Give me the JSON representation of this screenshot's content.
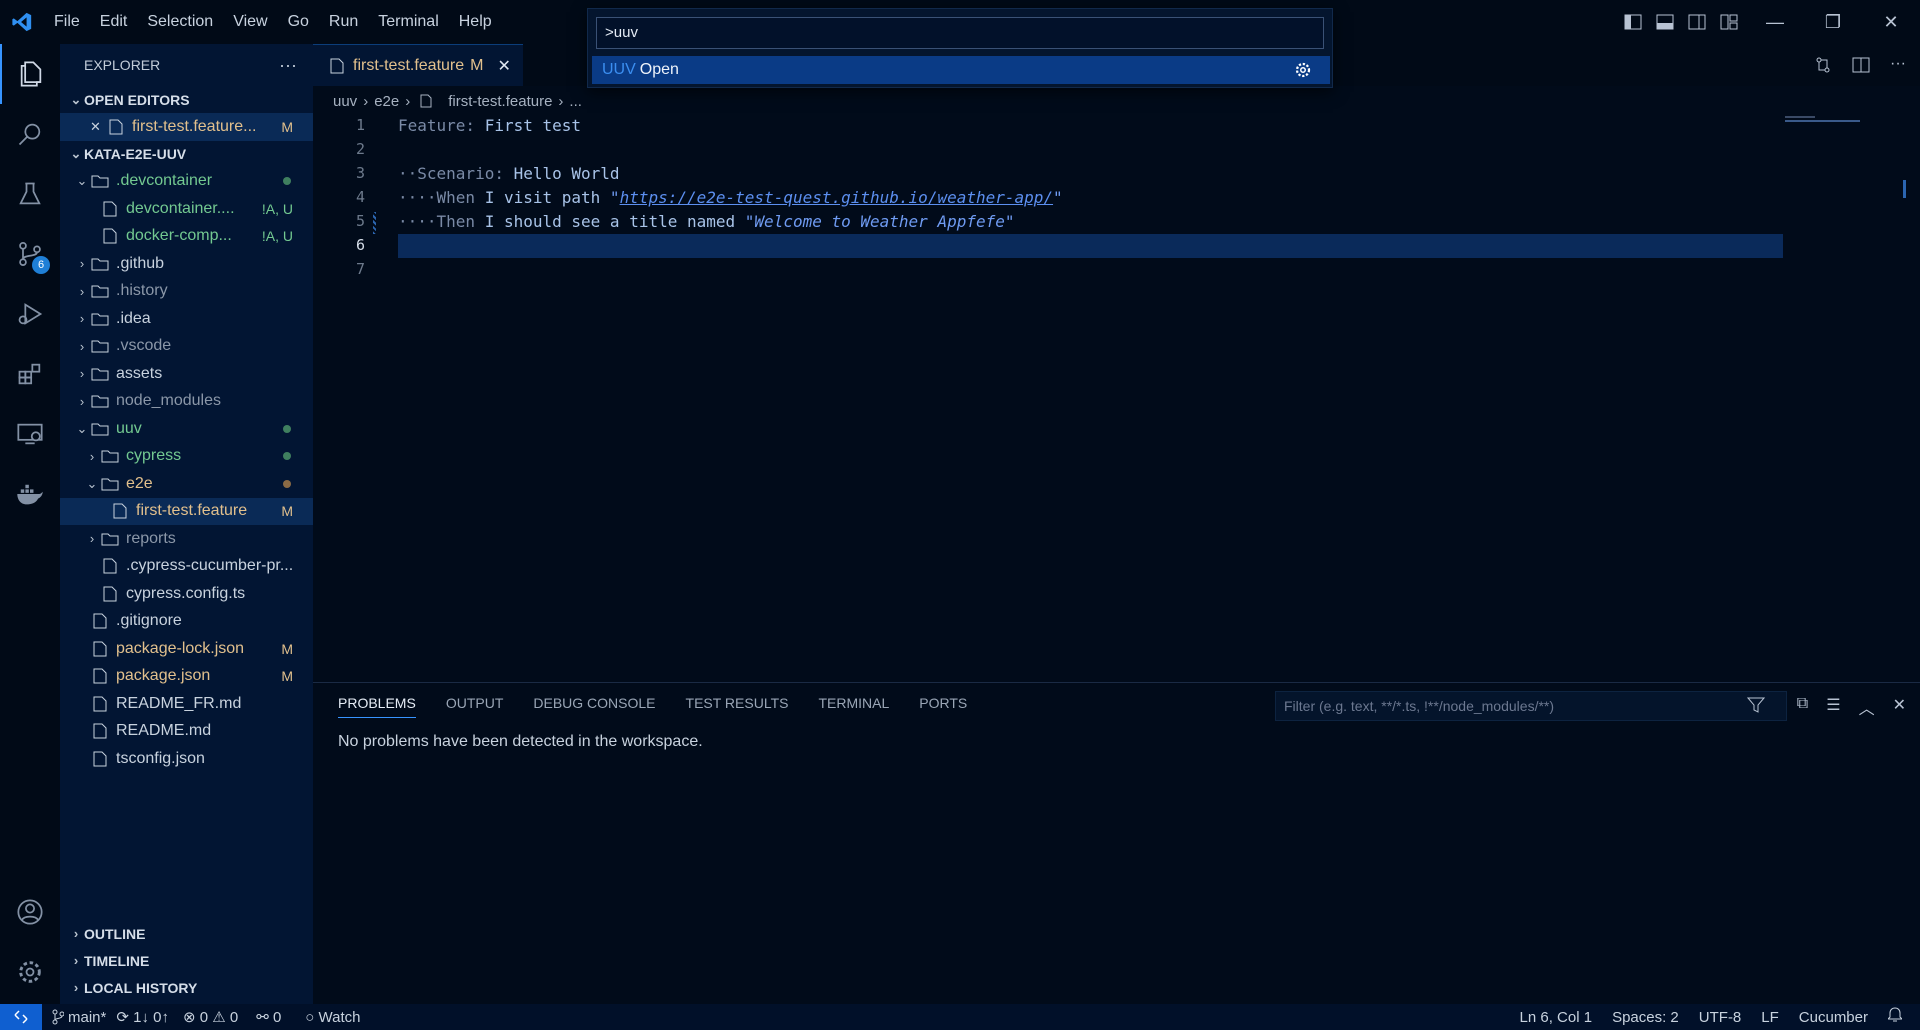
{
  "menu": [
    "File",
    "Edit",
    "Selection",
    "View",
    "Go",
    "Run",
    "Terminal",
    "Help"
  ],
  "palette": {
    "input": ">uuv",
    "item_prefix": "UUV",
    "item_label": "Open"
  },
  "activity": {
    "scm_badge": "6"
  },
  "sidebar": {
    "title": "EXPLORER",
    "open_editors": "OPEN EDITORS",
    "open_file": "first-test.feature...",
    "open_file_status": "M",
    "project": "KATA-E2E-UUV",
    "tree": [
      {
        "name": ".devcontainer",
        "indent": 0,
        "type": "folder-open",
        "cls": "add",
        "dot": "#3f7f5f"
      },
      {
        "name": "devcontainer....",
        "indent": 1,
        "type": "file",
        "cls": "add",
        "status": "!A, U"
      },
      {
        "name": "docker-comp...",
        "indent": 1,
        "type": "file",
        "cls": "add",
        "status": "!A, U"
      },
      {
        "name": ".github",
        "indent": 0,
        "type": "folder"
      },
      {
        "name": ".history",
        "indent": 0,
        "type": "folder",
        "cls": "ign"
      },
      {
        "name": ".idea",
        "indent": 0,
        "type": "folder"
      },
      {
        "name": ".vscode",
        "indent": 0,
        "type": "folder",
        "cls": "ign"
      },
      {
        "name": "assets",
        "indent": 0,
        "type": "folder"
      },
      {
        "name": "node_modules",
        "indent": 0,
        "type": "folder",
        "cls": "ign"
      },
      {
        "name": "uuv",
        "indent": 0,
        "type": "folder-open",
        "cls": "add",
        "dot": "#3f7f5f"
      },
      {
        "name": "cypress",
        "indent": 1,
        "type": "folder",
        "cls": "add",
        "dot": "#3f7f5f"
      },
      {
        "name": "e2e",
        "indent": 1,
        "type": "folder-open",
        "cls": "mod",
        "dot": "#8a6a45"
      },
      {
        "name": "first-test.feature",
        "indent": 2,
        "type": "file",
        "cls": "mod",
        "status": "M",
        "selected": true
      },
      {
        "name": "reports",
        "indent": 1,
        "type": "folder",
        "cls": "ign"
      },
      {
        "name": ".cypress-cucumber-pr...",
        "indent": 1,
        "type": "file"
      },
      {
        "name": "cypress.config.ts",
        "indent": 1,
        "type": "file"
      },
      {
        "name": ".gitignore",
        "indent": 0,
        "type": "file"
      },
      {
        "name": "package-lock.json",
        "indent": 0,
        "type": "file",
        "cls": "mod",
        "status": "M"
      },
      {
        "name": "package.json",
        "indent": 0,
        "type": "file",
        "cls": "mod",
        "status": "M"
      },
      {
        "name": "README_FR.md",
        "indent": 0,
        "type": "file"
      },
      {
        "name": "README.md",
        "indent": 0,
        "type": "file"
      },
      {
        "name": "tsconfig.json",
        "indent": 0,
        "type": "file"
      }
    ],
    "bottom": [
      "OUTLINE",
      "TIMELINE",
      "LOCAL HISTORY"
    ]
  },
  "tab": {
    "label": "first-test.feature",
    "status": "M"
  },
  "breadcrumb": [
    "uuv",
    "e2e",
    "first-test.feature",
    "..."
  ],
  "code": {
    "line_numbers": [
      "1",
      "2",
      "3",
      "4",
      "5",
      "6",
      "7"
    ],
    "l1_kw": "Feature:",
    "l1_tx": " First test",
    "l3_kw": "Scenario:",
    "l3_tx": " Hello World",
    "l4_kw": "When",
    "l4_tx": " I visit path ",
    "l4_q1": "\"",
    "l4_url": "https://e2e-test-quest.github.io/weather-app/",
    "l4_q2": "\"",
    "l5_kw": "Then",
    "l5_tx": " I should see a title named ",
    "l5_str": "\"Welcome to Weather Appfefe\""
  },
  "panel": {
    "tabs": [
      "PROBLEMS",
      "OUTPUT",
      "DEBUG CONSOLE",
      "TEST RESULTS",
      "TERMINAL",
      "PORTS"
    ],
    "filter_placeholder": "Filter (e.g. text, **/*.ts, !**/node_modules/**)",
    "message": "No problems have been detected in the workspace."
  },
  "status": {
    "branch": "main*",
    "sync": "1↓ 0↑",
    "errors": "0",
    "warnings": "0",
    "ports": "0",
    "watch": "Watch",
    "position": "Ln 6, Col 1",
    "spaces": "Spaces: 2",
    "encoding": "UTF-8",
    "eol": "LF",
    "language": "Cucumber"
  }
}
